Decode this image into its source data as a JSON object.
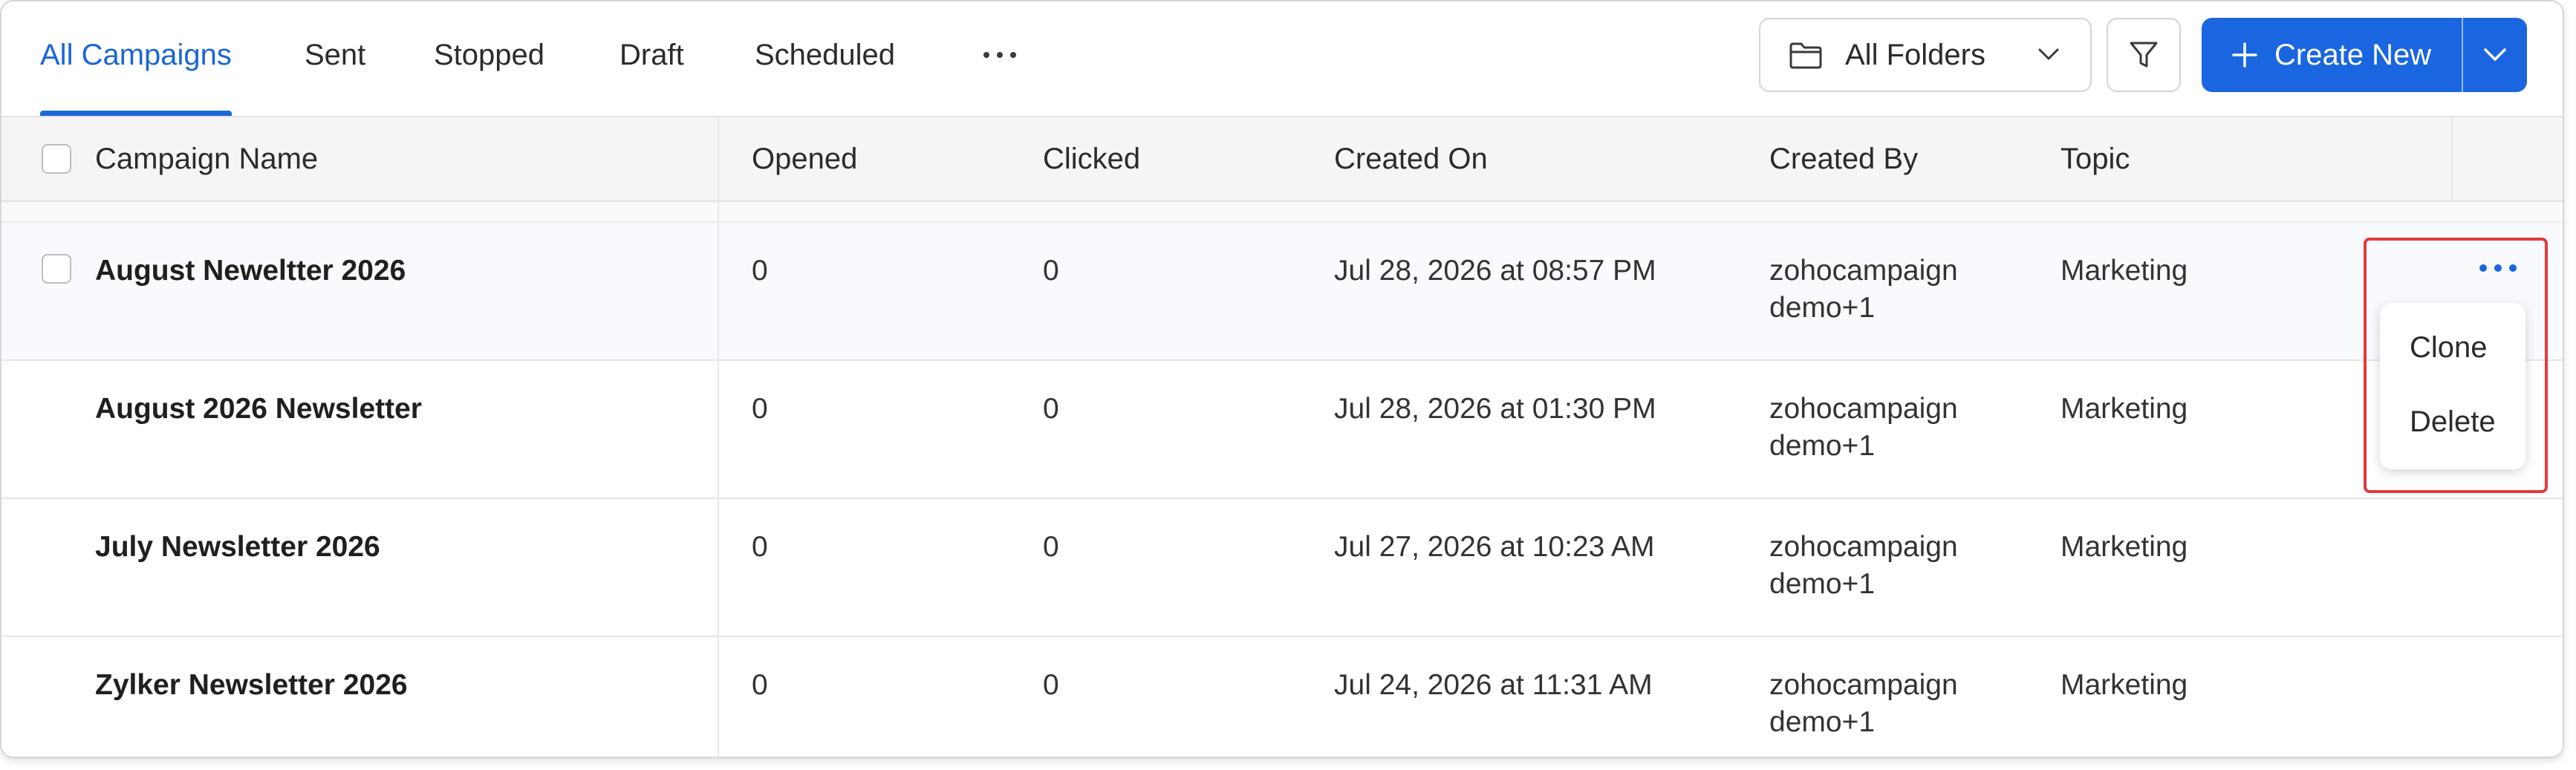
{
  "tabs": [
    {
      "label": "All Campaigns",
      "active": true
    },
    {
      "label": "Sent",
      "active": false
    },
    {
      "label": "Stopped",
      "active": false
    },
    {
      "label": "Draft",
      "active": false
    },
    {
      "label": "Scheduled",
      "active": false
    }
  ],
  "toolbar": {
    "folder_label": "All Folders",
    "create_label": "Create New"
  },
  "table": {
    "headers": [
      "Campaign Name",
      "Opened",
      "Clicked",
      "Created On",
      "Created By",
      "Topic"
    ],
    "rows": [
      {
        "name": "August Neweltter 2026",
        "opened": "0",
        "clicked": "0",
        "created_on": "Jul 28, 2026 at 08:57 PM",
        "created_by_1": "zohocampaign",
        "created_by_2": "demo+1",
        "topic": "Marketing"
      },
      {
        "name": "August 2026 Newsletter",
        "opened": "0",
        "clicked": "0",
        "created_on": "Jul 28, 2026 at 01:30 PM",
        "created_by_1": "zohocampaign",
        "created_by_2": "demo+1",
        "topic": "Marketing"
      },
      {
        "name": "July Newsletter 2026",
        "opened": "0",
        "clicked": "0",
        "created_on": "Jul 27, 2026 at 10:23 AM",
        "created_by_1": "zohocampaign",
        "created_by_2": "demo+1",
        "topic": "Marketing"
      },
      {
        "name": "Zylker Newsletter 2026",
        "opened": "0",
        "clicked": "0",
        "created_on": "Jul 24, 2026 at 11:31 AM",
        "created_by_1": "zohocampaign",
        "created_by_2": "demo+1",
        "topic": "Marketing"
      }
    ]
  },
  "row_menu": {
    "items": [
      "Clone",
      "Delete"
    ]
  },
  "colors": {
    "accent": "#1a66e0",
    "highlight": "#e23a3a"
  },
  "icons": [
    "more-horizontal-icon",
    "folder-icon",
    "chevron-down-icon",
    "filter-icon",
    "plus-icon"
  ]
}
